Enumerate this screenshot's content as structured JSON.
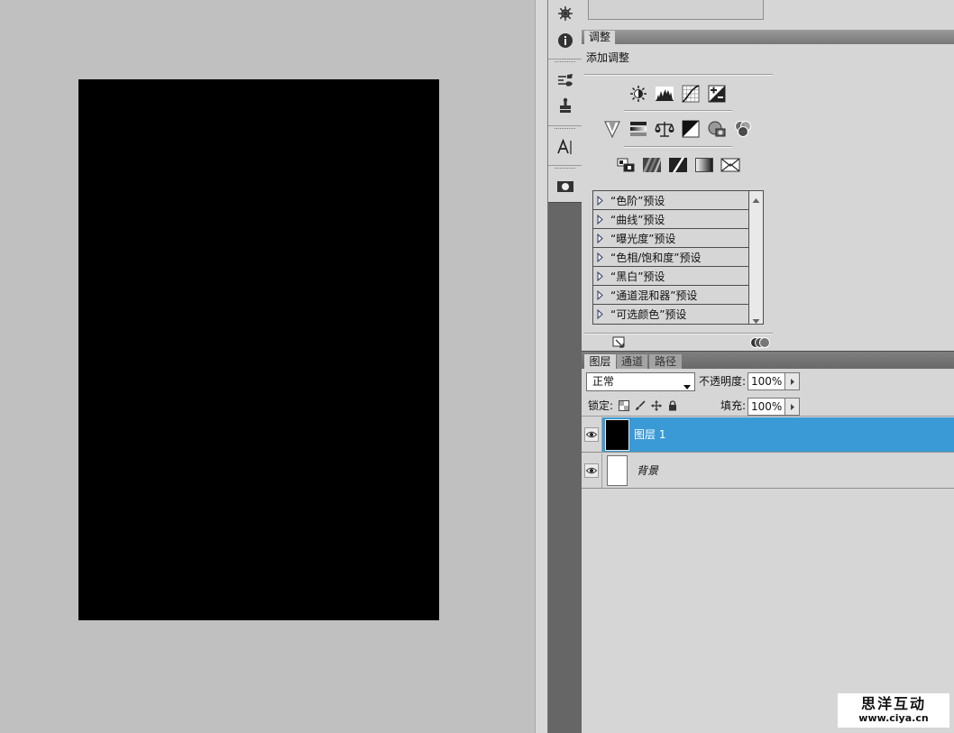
{
  "colors": {
    "canvas": "#c0c0c0",
    "document": "#000000",
    "panel": "#d6d6d6",
    "dock": "#666666",
    "selection": "#3a9ad6"
  },
  "icon_dock": {
    "icons": [
      "navigator-icon",
      "info-icon",
      "brushes-icon",
      "clone-source-icon",
      "character-icon",
      "masks-icon"
    ]
  },
  "adjustments_panel": {
    "tab": "调整",
    "heading": "添加调整",
    "icon_rows": [
      [
        "brightness-contrast-icon",
        "levels-icon",
        "curves-icon",
        "exposure-icon"
      ],
      [
        "vibrance-icon",
        "hue-saturation-icon",
        "color-balance-icon",
        "black-white-icon",
        "photo-filter-icon",
        "channel-mixer-icon"
      ],
      [
        "invert-icon",
        "posterize-icon",
        "threshold-icon",
        "gradient-map-icon",
        "selective-color-icon"
      ]
    ],
    "presets": [
      "“色阶”预设",
      "“曲线”预设",
      "“曝光度”预设",
      "“色相/饱和度”预设",
      "“黑白”预设",
      "“通道混和器”预设",
      "“可选颜色”预设"
    ],
    "footer_icons": [
      "expand-view-icon",
      "overlap-circles-icon"
    ]
  },
  "layers_panel": {
    "tabs": [
      "图层",
      "通道",
      "路径"
    ],
    "active_tab_index": 0,
    "blend_mode": "正常",
    "opacity_label": "不透明度:",
    "opacity_value": "100%",
    "lock_label": "锁定:",
    "lock_icons": [
      "lock-transparent-pixels-icon",
      "lock-image-pixels-icon",
      "lock-position-icon",
      "lock-all-icon"
    ],
    "fill_label": "填充:",
    "fill_value": "100%",
    "layers": [
      {
        "name": "图层 1",
        "visible": true,
        "selected": true,
        "thumbnail": "#000000"
      },
      {
        "name": "背景",
        "visible": true,
        "selected": false,
        "thumbnail": "#ffffff"
      }
    ]
  },
  "watermark": {
    "title": "思洋互动",
    "url": "www.ciya.cn"
  }
}
